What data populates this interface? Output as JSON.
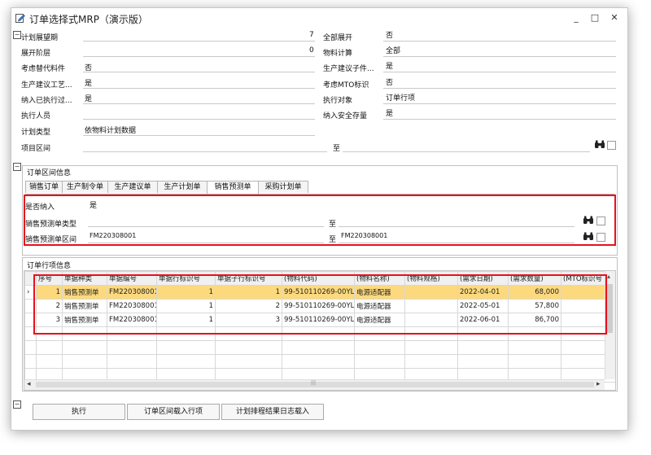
{
  "window": {
    "title": "订单选择式MRP（演示版）",
    "minimize": "_",
    "maximize": "□",
    "close": "✕"
  },
  "params": {
    "plan_horizon": {
      "label": "计划展望期",
      "value": "7"
    },
    "expand_level": {
      "label": "展开阶层",
      "value": "0"
    },
    "consider_substitute": {
      "label": "考虑替代料件",
      "value": "否"
    },
    "gen_process": {
      "label": "生产建议工艺...",
      "value": "是"
    },
    "include_executed": {
      "label": "纳入已执行过...",
      "value": "是"
    },
    "executor": {
      "label": "执行人员",
      "value": ""
    },
    "plan_type": {
      "label": "计划类型",
      "value": "依物料计划数据"
    },
    "project_range": {
      "label": "项目区间",
      "to": "至"
    },
    "expand_all": {
      "label": "全部展开",
      "value": "否"
    },
    "material_calc": {
      "label": "物料计算",
      "value": "全部"
    },
    "gen_child": {
      "label": "生产建议子件...",
      "value": "是"
    },
    "mto_flag": {
      "label": "考虑MTO标识",
      "value": "否"
    },
    "exec_object": {
      "label": "执行对象",
      "value": "订单行项"
    },
    "include_safety": {
      "label": "纳入安全存量",
      "value": "是"
    }
  },
  "order_range": {
    "title": "订单区间信息",
    "tabs": [
      "销售订单",
      "生产制令单",
      "生产建议单",
      "生产计划单",
      "销售预测单",
      "采购计划单"
    ],
    "active_tab": 4,
    "include": {
      "label": "是否纳入",
      "value": "是"
    },
    "type": {
      "label": "销售预测单类型",
      "to": "至"
    },
    "range": {
      "label": "销售预测单区间",
      "from": "FM220308001",
      "to_label": "至",
      "to": "FM220308001"
    }
  },
  "items": {
    "title": "订单行项信息",
    "columns": [
      "序号",
      "单据种类",
      "单据编号",
      "单据行标识号",
      "单据子行标识号",
      "(物料代码)",
      "(物料名称)",
      "(物料规格)",
      "(需求日期)",
      "(需求数量)",
      "(MTO标识号"
    ],
    "rows": [
      {
        "no": "1",
        "kind": "销售预测单",
        "doc": "FM220308001",
        "line": "1",
        "sub": "1",
        "code": "99-510110269-00YL",
        "name": "电源适配器",
        "spec": "",
        "date": "2022-04-01",
        "qty": "68,000",
        "mto": ""
      },
      {
        "no": "2",
        "kind": "销售预测单",
        "doc": "FM220308001",
        "line": "1",
        "sub": "2",
        "code": "99-510110269-00YL",
        "name": "电源适配器",
        "spec": "",
        "date": "2022-05-01",
        "qty": "57,800",
        "mto": ""
      },
      {
        "no": "3",
        "kind": "销售预测单",
        "doc": "FM220308001",
        "line": "1",
        "sub": "3",
        "code": "99-510110269-00YL",
        "name": "电源适配器",
        "spec": "",
        "date": "2022-06-01",
        "qty": "86,700",
        "mto": ""
      }
    ],
    "row_pointer": "›",
    "scroll_left": "◂",
    "scroll_right": "▸",
    "scroll_up": "▴",
    "scroll_thumb": "|||"
  },
  "buttons": {
    "execute": "执行",
    "load_lines": "订单区间载入行项",
    "load_log": "计划排程结果日志载入"
  },
  "colors": {
    "highlight_border": "#e8101c",
    "selected_row": "#fdd97d"
  },
  "icons": {
    "title": "edit-icon",
    "binoculars": "binoculars-icon"
  }
}
